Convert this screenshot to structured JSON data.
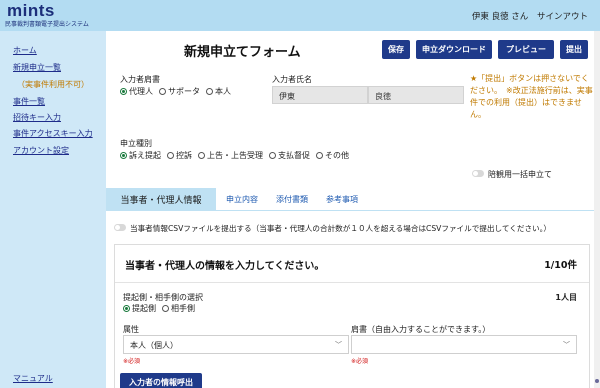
{
  "header": {
    "logo": "mints",
    "logo_sub": "民事裁判書類電子提出システム",
    "user_name": "伊東 良徳 さん",
    "signout": "サインアウト"
  },
  "sidebar": {
    "items": [
      {
        "label": "ホーム"
      },
      {
        "label": "新規申立一覧"
      },
      {
        "label": "（実事件利用不可）"
      },
      {
        "label": "事件一覧"
      },
      {
        "label": "招待キー入力"
      },
      {
        "label": "事件アクセスキー入力"
      },
      {
        "label": "アカウント設定"
      }
    ],
    "manual": "マニュアル"
  },
  "page": {
    "title": "新規申立てフォーム",
    "buttons": {
      "save": "保存",
      "download": "申立ダウンロード",
      "preview": "プレビュー",
      "submit": "提出"
    }
  },
  "form": {
    "role_label": "入力者肩書",
    "role_options": [
      "代理人",
      "サポータ",
      "本人"
    ],
    "role_selected": 0,
    "name_label": "入力者氏名",
    "last_name": "伊東",
    "first_name": "良徳",
    "notice": "★「提出」ボタンは押さないでください。　※改正法施行前は、実事件での利用（提出）はできません。",
    "type_label": "申立種別",
    "type_options": [
      "訴え提起",
      "控訴",
      "上告・上告受理",
      "支払督促",
      "その他"
    ],
    "type_selected": 0,
    "bulk_toggle_label": "陪観用一括申立て"
  },
  "tabs": [
    {
      "label": "当事者・代理人情報",
      "active": true
    },
    {
      "label": "申立内容",
      "active": false
    },
    {
      "label": "添付書類",
      "active": false
    },
    {
      "label": "参考事項",
      "active": false
    }
  ],
  "csv_toggle_label": "当事者情報CSVファイルを提出する（当事者・代理人の合計数が１０人を超える場合はCSVファイルで提出してください。）",
  "card": {
    "title": "当事者・代理人の情報を入力してください。",
    "count": "1/10件",
    "side_label": "提起側・相手側の選択",
    "person_count": "1人目",
    "side_options": [
      "提起側",
      "相手側"
    ],
    "side_selected": 0,
    "attr_label": "属性",
    "attr_value": "本人（個人）",
    "title_label": "肩書（自由入力することができます。）",
    "title_value": "",
    "required": "※必須",
    "lookup_button": "入力者の情報呼出"
  }
}
